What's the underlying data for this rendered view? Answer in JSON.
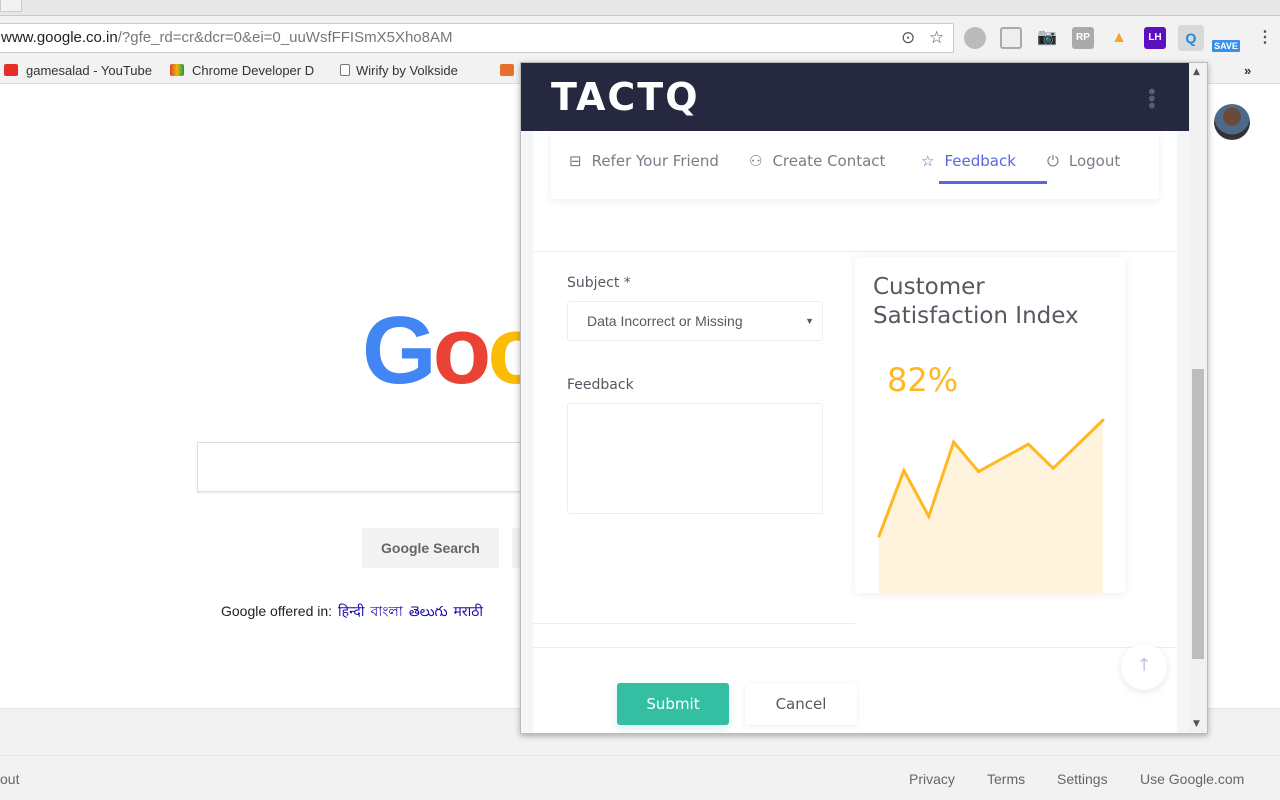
{
  "browser": {
    "url_host": "www.google.co.in",
    "url_rest": "/?gfe_rd=cr&dcr=0&ei=0_uuWsfFFISmX5Xho8AM",
    "extensions": [
      {
        "name": "cloud-extension-icon",
        "label": ""
      },
      {
        "name": "layout-extension-icon",
        "label": ""
      },
      {
        "name": "camera-extension-icon",
        "label": ""
      },
      {
        "name": "rp-extension-icon",
        "label": "RP"
      },
      {
        "name": "firebase-extension-icon",
        "label": ""
      },
      {
        "name": "lh-extension-icon",
        "label": "LH"
      },
      {
        "name": "tacta-extension-icon",
        "label": "Q"
      },
      {
        "name": "save-extension-icon",
        "label": "SAVE"
      }
    ],
    "bookmarks": [
      "gamesalad - YouTube",
      "Chrome Developer D",
      "Wirify by Volkside"
    ],
    "overflow": "»"
  },
  "google": {
    "logo": "Goo",
    "search_button": "Google Search",
    "offered_in": "Google offered in:",
    "languages": [
      "हिन्दी",
      "বাংলা",
      "తెలుగు",
      "मराठी"
    ],
    "footer_left": "out",
    "footer_links": [
      "Privacy",
      "Terms",
      "Settings",
      "Use Google.com"
    ]
  },
  "popup": {
    "brand": "TACTQ",
    "nav": [
      {
        "label": "Refer Your Friend",
        "icon": "briefcase-icon"
      },
      {
        "label": "Create Contact",
        "icon": "add-user-icon"
      },
      {
        "label": "Feedback",
        "icon": "star-icon",
        "active": true
      },
      {
        "label": "Logout",
        "icon": "power-icon"
      }
    ],
    "form": {
      "subject_label": "Subject *",
      "subject_value": "Data Incorrect or Missing",
      "feedback_label": "Feedback",
      "feedback_value": "",
      "submit": "Submit",
      "cancel": "Cancel"
    },
    "card": {
      "title": "Customer Satisfaction Index",
      "value": "82%"
    },
    "colors": {
      "header": "#262840",
      "accent": "#5867dd",
      "success": "#34bfa3",
      "warning": "#ffb822"
    }
  },
  "chart_data": {
    "type": "area",
    "x": [
      0,
      1,
      2,
      3,
      4,
      6,
      7,
      9
    ],
    "values": [
      52,
      112,
      70,
      138,
      111,
      136,
      114,
      158
    ],
    "xlim": [
      0,
      9
    ],
    "ylim": [
      0,
      170
    ],
    "grid": false,
    "color": "#ffb822"
  }
}
